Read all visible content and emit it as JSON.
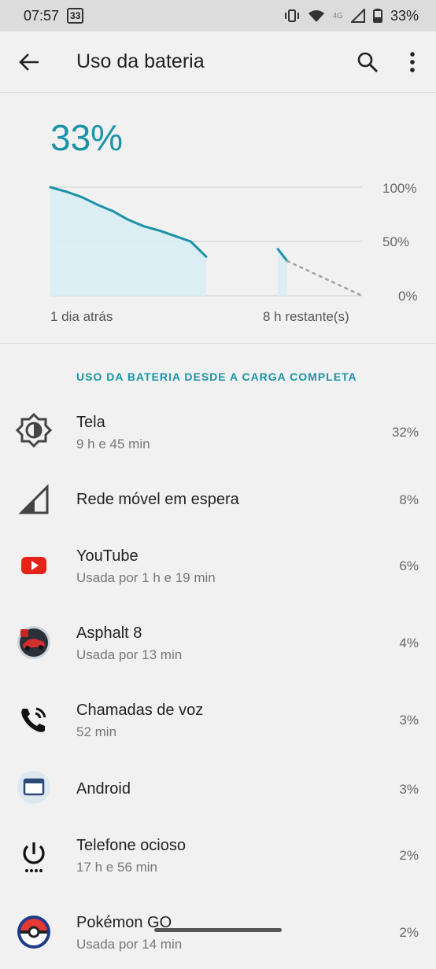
{
  "status_bar": {
    "time": "07:57",
    "notification_badge": "33",
    "network_type": "4G",
    "battery_text": "33%"
  },
  "app_bar": {
    "title": "Uso da bateria"
  },
  "battery": {
    "percent_display": "33%"
  },
  "chart_data": {
    "type": "line",
    "y_ticks": [
      "100%",
      "50%",
      "0%"
    ],
    "x_labels": [
      "1 dia atrás",
      "8 h restante(s)"
    ],
    "ylim": [
      0,
      100
    ],
    "grid": true,
    "series": [
      {
        "x": [
          0,
          5,
          10,
          15,
          20,
          25,
          30,
          35,
          40,
          45,
          50
        ],
        "y": [
          100,
          96,
          91,
          84,
          78,
          70,
          64,
          60,
          55,
          50,
          36
        ]
      },
      {
        "x": [
          73,
          76
        ],
        "y": [
          43,
          32
        ]
      }
    ],
    "projection": {
      "x": [
        76,
        100
      ],
      "y": [
        32,
        0
      ]
    },
    "gap_range": [
      50,
      73
    ]
  },
  "section": {
    "title": "USO DA BATERIA DESDE A CARGA COMPLETA"
  },
  "usage_items": [
    {
      "icon": "screen-brightness-icon",
      "name": "Tela",
      "detail": "9 h e 45 min",
      "percent": "32%"
    },
    {
      "icon": "cell-signal-icon",
      "name": "Rede móvel em espera",
      "detail": "",
      "percent": "8%"
    },
    {
      "icon": "youtube-icon",
      "name": "YouTube",
      "detail": "Usada por 1 h e 19 min",
      "percent": "6%"
    },
    {
      "icon": "asphalt8-icon",
      "name": "Asphalt 8",
      "detail": "Usada por 13 min",
      "percent": "4%"
    },
    {
      "icon": "phone-call-icon",
      "name": "Chamadas de voz",
      "detail": "52 min",
      "percent": "3%"
    },
    {
      "icon": "android-system-icon",
      "name": "Android",
      "detail": "",
      "percent": "3%"
    },
    {
      "icon": "power-idle-icon",
      "name": "Telefone ocioso",
      "detail": "17 h e 56 min",
      "percent": "2%"
    },
    {
      "icon": "pokeball-icon",
      "name": "Pokémon GO",
      "detail": "Usada por 14 min",
      "percent": "2%"
    }
  ],
  "colors": {
    "accent": "#1a93a8",
    "chart_fill": "#d8edf3",
    "background": "#f1f1f1",
    "status_bar": "#dcdcdc"
  }
}
